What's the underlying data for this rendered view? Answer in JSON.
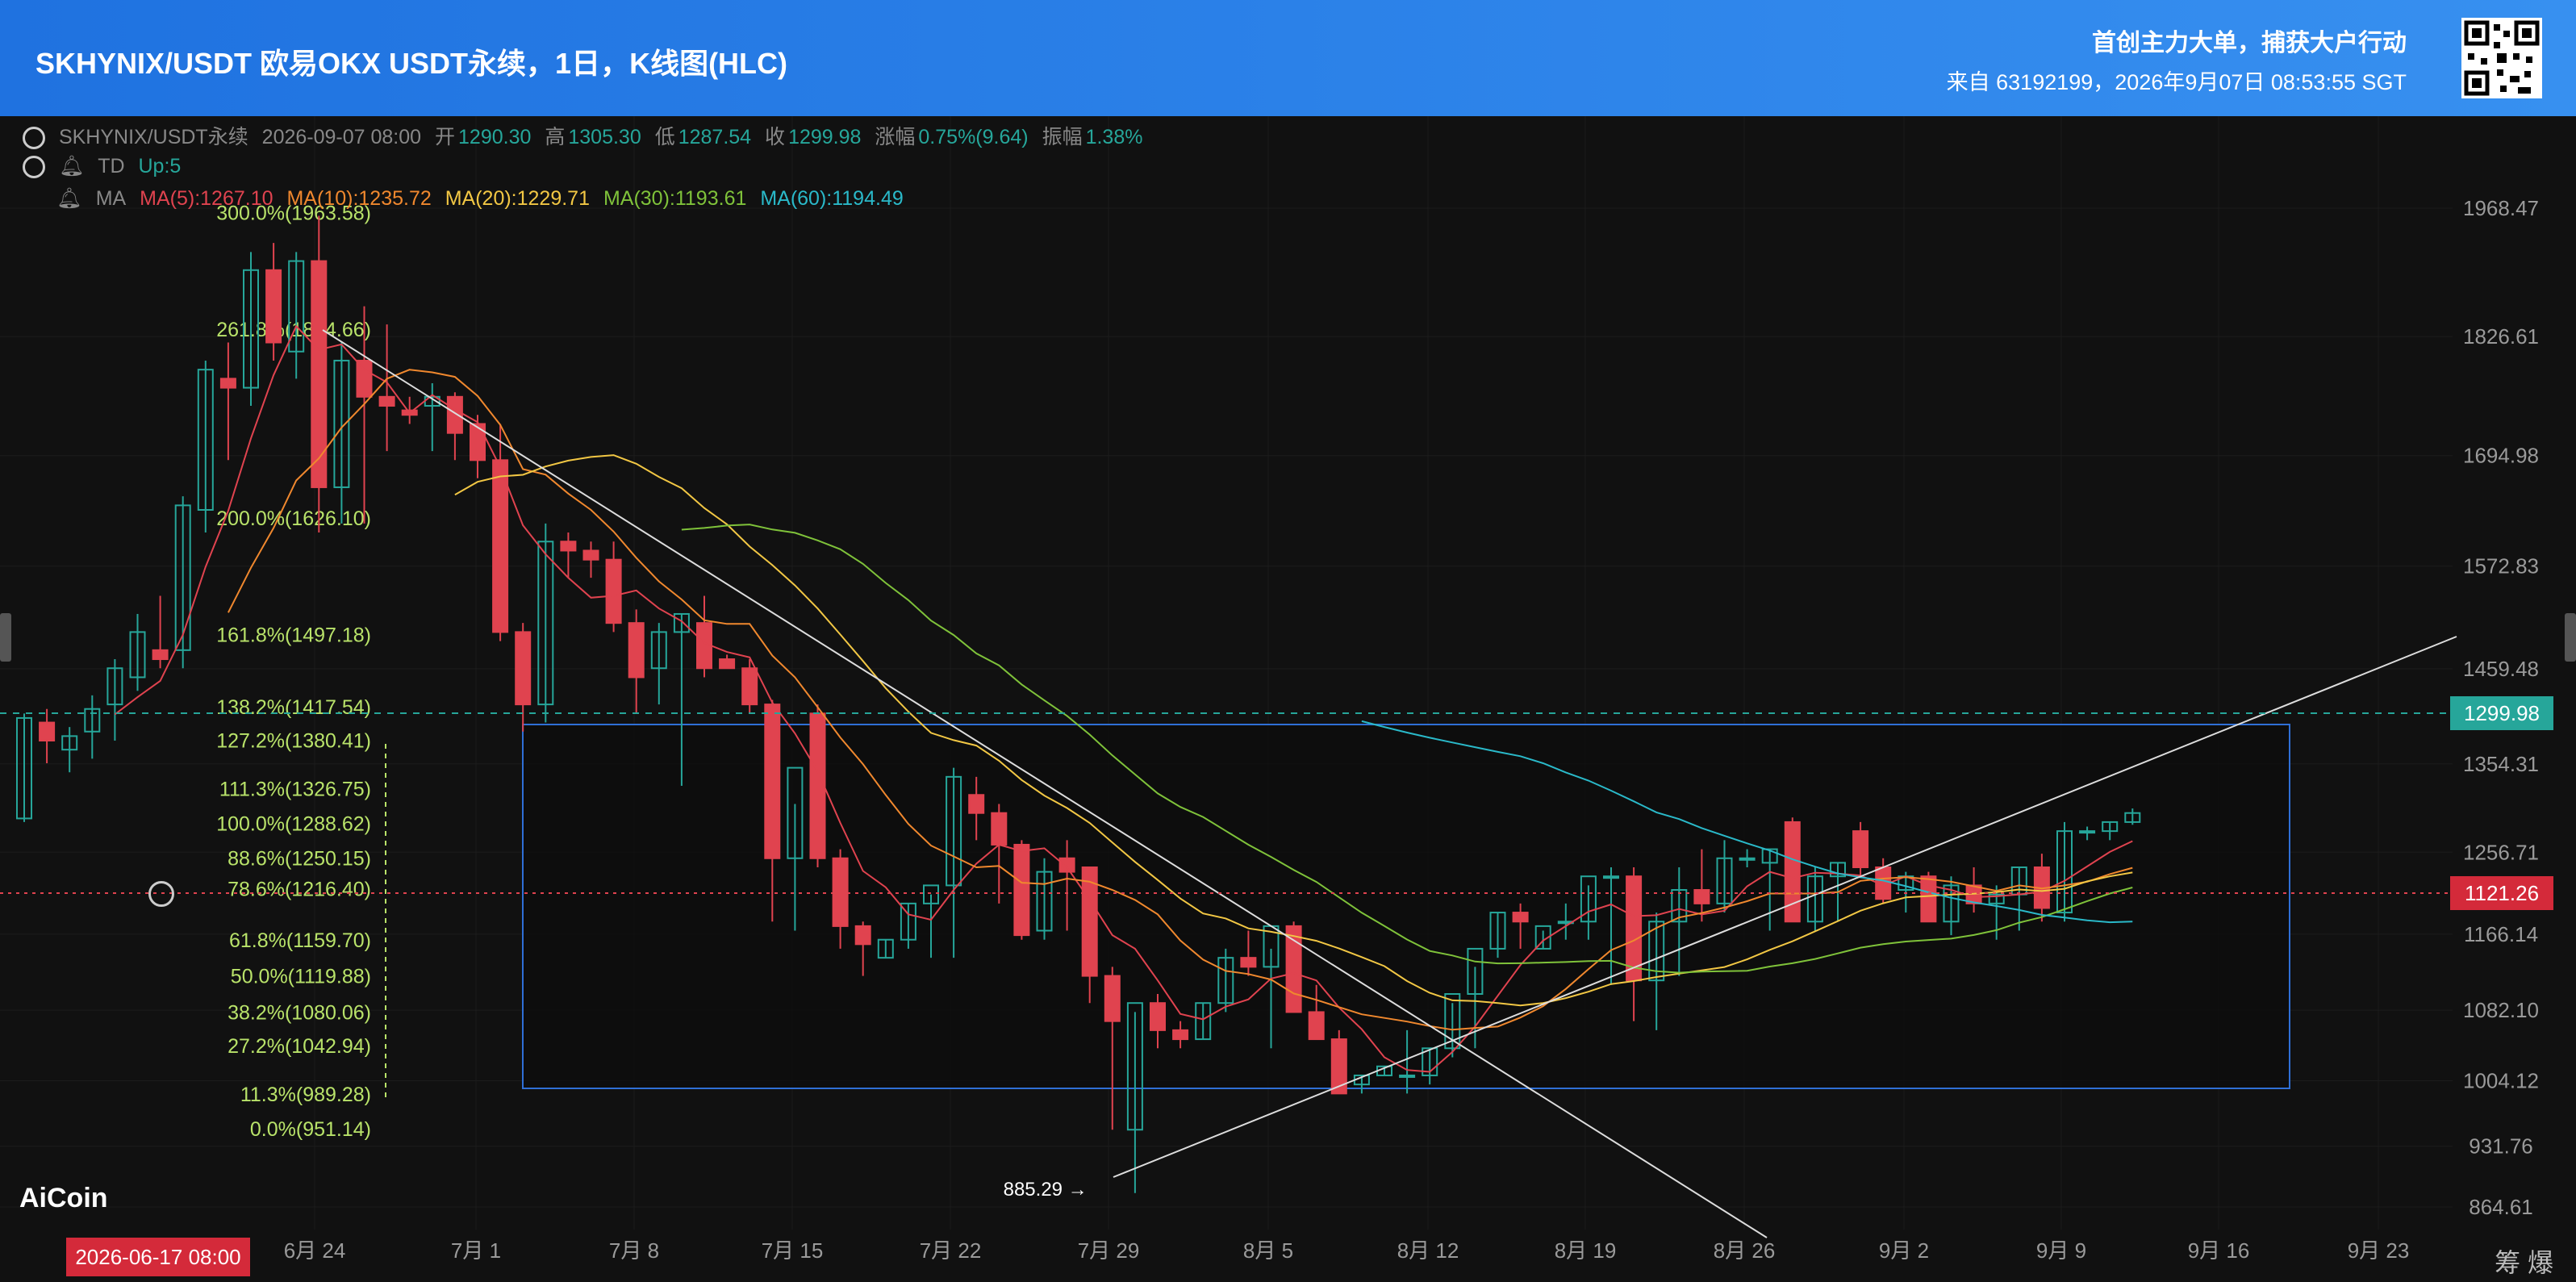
{
  "header": {
    "title": "SKHYNIX/USDT 欧易OKX USDT永续，1日，K线图(HLC)",
    "slogan": "首创主力大单，捕获大户行动",
    "source": "来自 63192199，2026年9月07日 08:53:55 SGT"
  },
  "info": {
    "symbol": "SKHYNIX/USDT永续",
    "datetime": "2026-09-07 08:00",
    "open_label": "开",
    "open": "1290.30",
    "high_label": "高",
    "high": "1305.30",
    "low_label": "低",
    "low": "1287.54",
    "close_label": "收",
    "close": "1299.98",
    "change_label": "涨幅",
    "change": "0.75%(9.64)",
    "amp_label": "振幅",
    "amp": "1.38%",
    "td_label": "TD",
    "td_value": "Up:5",
    "ma_label": "MA",
    "ma5": "MA(5):1267.10",
    "ma10": "MA(10):1235.72",
    "ma20": "MA(20):1229.71",
    "ma30": "MA(30):1193.61",
    "ma60": "MA(60):1194.49"
  },
  "current_price_label": "1299.98",
  "cursor_price_label": "1121.26",
  "cursor_date_label": "2026-06-17 08:00",
  "logo": "AiCoin",
  "chou_label": "筹 爆",
  "colors": {
    "up": "#26a69a",
    "down": "#e0434f",
    "ma5": "#e0434f",
    "ma10": "#f0882e",
    "ma20": "#f2c744",
    "ma30": "#7fc23a",
    "ma60": "#2ab9c9",
    "fib_text": "#b9e36a",
    "rect": "#2f6fd6"
  },
  "chart_data": {
    "type": "candlestick",
    "yticks": [
      1968.47,
      1826.61,
      1694.98,
      1572.83,
      1459.48,
      1354.31,
      1256.71,
      1166.14,
      1082.1,
      1004.12,
      931.76,
      864.61
    ],
    "xticks": [
      "6月 24",
      "7月 1",
      "7月 8",
      "7月 15",
      "7月 22",
      "7月 29",
      "8月 5",
      "8月 12",
      "8月 19",
      "8月 26",
      "9月 2",
      "9月 9",
      "9月 16",
      "9月 23"
    ],
    "fib_levels": [
      {
        "label": "300.0%(1963.58)",
        "value": 1963.58
      },
      {
        "label": "261.8%(1834.66)",
        "value": 1834.66
      },
      {
        "label": "200.0%(1626.10)",
        "value": 1626.1
      },
      {
        "label": "161.8%(1497.18)",
        "value": 1497.18
      },
      {
        "label": "138.2%(1417.54)",
        "value": 1417.54
      },
      {
        "label": "127.2%(1380.41)",
        "value": 1380.41
      },
      {
        "label": "111.3%(1326.75)",
        "value": 1326.75
      },
      {
        "label": "100.0%(1288.62)",
        "value": 1288.62
      },
      {
        "label": "88.6%(1250.15)",
        "value": 1250.15
      },
      {
        "label": "78.6%(1216.40)",
        "value": 1216.4
      },
      {
        "label": "61.8%(1159.70)",
        "value": 1159.7
      },
      {
        "label": "50.0%(1119.88)",
        "value": 1119.88
      },
      {
        "label": "38.2%(1080.06)",
        "value": 1080.06
      },
      {
        "label": "27.2%(1042.94)",
        "value": 1042.94
      },
      {
        "label": "11.3%(989.28)",
        "value": 989.28
      },
      {
        "label": "0.0%(951.14)",
        "value": 951.14
      }
    ],
    "low_marker": {
      "label": "885.29 →",
      "value": 885.29,
      "index": 47
    },
    "current_price": 1299.98,
    "cursor_price": 1121.26,
    "candles": [
      [
        1294,
        1410,
        1290,
        1405
      ],
      [
        1400,
        1415,
        1355,
        1380
      ],
      [
        1370,
        1395,
        1345,
        1385
      ],
      [
        1390,
        1430,
        1360,
        1415
      ],
      [
        1420,
        1470,
        1380,
        1460
      ],
      [
        1450,
        1520,
        1435,
        1500
      ],
      [
        1480,
        1540,
        1460,
        1470
      ],
      [
        1480,
        1650,
        1460,
        1640
      ],
      [
        1635,
        1800,
        1610,
        1790
      ],
      [
        1780,
        1820,
        1690,
        1770
      ],
      [
        1770,
        1920,
        1750,
        1900
      ],
      [
        1900,
        1930,
        1800,
        1820
      ],
      [
        1810,
        1920,
        1780,
        1910
      ],
      [
        1910,
        1960,
        1610,
        1660
      ],
      [
        1660,
        1820,
        1620,
        1800
      ],
      [
        1800,
        1860,
        1620,
        1760
      ],
      [
        1760,
        1840,
        1700,
        1750
      ],
      [
        1745,
        1760,
        1730,
        1740
      ],
      [
        1750,
        1775,
        1700,
        1760
      ],
      [
        1760,
        1765,
        1690,
        1720
      ],
      [
        1730,
        1740,
        1670,
        1690
      ],
      [
        1690,
        1730,
        1490,
        1500
      ],
      [
        1500,
        1510,
        1390,
        1420
      ],
      [
        1420,
        1620,
        1400,
        1600
      ],
      [
        1600,
        1610,
        1560,
        1590
      ],
      [
        1590,
        1600,
        1560,
        1580
      ],
      [
        1580,
        1600,
        1500,
        1510
      ],
      [
        1510,
        1525,
        1410,
        1450
      ],
      [
        1460,
        1510,
        1420,
        1500
      ],
      [
        1500,
        1520,
        1330,
        1520
      ],
      [
        1510,
        1540,
        1450,
        1460
      ],
      [
        1470,
        1475,
        1460,
        1460
      ],
      [
        1460,
        1470,
        1410,
        1420
      ],
      [
        1420,
        1425,
        1180,
        1250
      ],
      [
        1250,
        1310,
        1170,
        1350
      ],
      [
        1410,
        1420,
        1240,
        1250
      ],
      [
        1250,
        1260,
        1150,
        1175
      ],
      [
        1175,
        1180,
        1120,
        1155
      ],
      [
        1140,
        1160,
        1140,
        1160
      ],
      [
        1160,
        1200,
        1150,
        1200
      ],
      [
        1200,
        1210,
        1140,
        1220
      ],
      [
        1220,
        1350,
        1140,
        1340
      ],
      [
        1320,
        1340,
        1270,
        1300
      ],
      [
        1300,
        1310,
        1200,
        1265
      ],
      [
        1265,
        1270,
        1160,
        1165
      ],
      [
        1170,
        1250,
        1160,
        1235
      ],
      [
        1250,
        1270,
        1170,
        1235
      ],
      [
        1240,
        1230,
        1090,
        1120
      ],
      [
        1120,
        1130,
        950,
        1070
      ],
      [
        950,
        1080,
        880,
        1090
      ],
      [
        1090,
        1100,
        1040,
        1060
      ],
      [
        1060,
        1070,
        1040,
        1050
      ],
      [
        1050,
        1090,
        1050,
        1090
      ],
      [
        1090,
        1150,
        1080,
        1140
      ],
      [
        1140,
        1170,
        1120,
        1130
      ],
      [
        1130,
        1150,
        1040,
        1175
      ],
      [
        1175,
        1180,
        1090,
        1080
      ],
      [
        1080,
        1110,
        1060,
        1050
      ],
      [
        1050,
        1060,
        990,
        990
      ],
      [
        1000,
        1010,
        990,
        1010
      ],
      [
        1010,
        1020,
        1010,
        1020
      ],
      [
        1010,
        1060,
        990,
        1010
      ],
      [
        1010,
        1040,
        1000,
        1040
      ],
      [
        1040,
        1090,
        1030,
        1100
      ],
      [
        1100,
        1130,
        1040,
        1150
      ],
      [
        1150,
        1190,
        1140,
        1190
      ],
      [
        1190,
        1200,
        1150,
        1180
      ],
      [
        1150,
        1170,
        1150,
        1175
      ],
      [
        1180,
        1200,
        1160,
        1180
      ],
      [
        1180,
        1220,
        1160,
        1230
      ],
      [
        1230,
        1240,
        1110,
        1230
      ],
      [
        1230,
        1240,
        1070,
        1115
      ],
      [
        1115,
        1190,
        1060,
        1180
      ],
      [
        1180,
        1240,
        1120,
        1215
      ],
      [
        1215,
        1260,
        1180,
        1200
      ],
      [
        1200,
        1270,
        1190,
        1250
      ],
      [
        1250,
        1260,
        1240,
        1250
      ],
      [
        1245,
        1260,
        1170,
        1260
      ],
      [
        1290,
        1295,
        1180,
        1180
      ],
      [
        1180,
        1240,
        1170,
        1230
      ],
      [
        1230,
        1245,
        1180,
        1245
      ],
      [
        1280,
        1290,
        1230,
        1240
      ],
      [
        1240,
        1250,
        1200,
        1205
      ],
      [
        1215,
        1235,
        1190,
        1230
      ],
      [
        1230,
        1235,
        1180,
        1180
      ],
      [
        1180,
        1230,
        1165,
        1220
      ],
      [
        1220,
        1240,
        1190,
        1200
      ],
      [
        1200,
        1220,
        1160,
        1210
      ],
      [
        1210,
        1240,
        1170,
        1240
      ],
      [
        1240,
        1255,
        1180,
        1195
      ],
      [
        1190,
        1290,
        1180,
        1280
      ],
      [
        1280,
        1285,
        1270,
        1280
      ],
      [
        1280,
        1290,
        1270,
        1290
      ],
      [
        1290,
        1305,
        1287,
        1300
      ]
    ]
  }
}
